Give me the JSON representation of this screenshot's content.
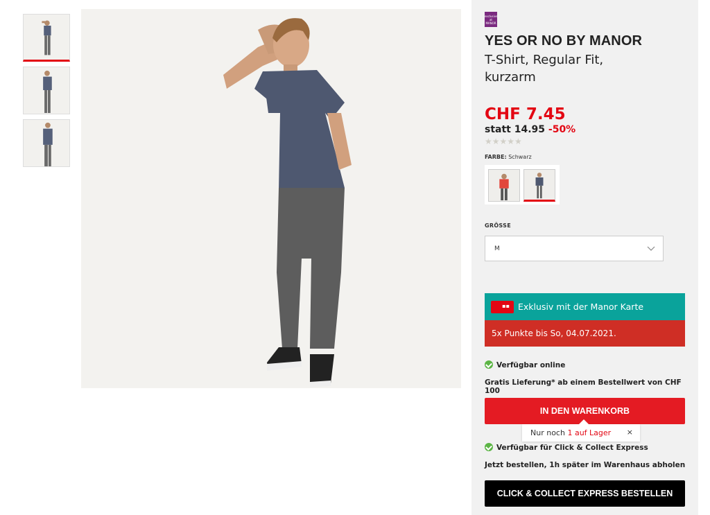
{
  "gallery": {
    "thumbnails": [
      {
        "alt": "front-view",
        "active": true
      },
      {
        "alt": "angle-view",
        "active": false
      },
      {
        "alt": "side-view",
        "active": false
      }
    ]
  },
  "product": {
    "brand_logo_text": "exclusive at MANOR",
    "brand": "YES OR NO BY MANOR",
    "name": "T-Shirt, Regular Fit, kurzarm",
    "price": "CHF 7.45",
    "old_price_prefix": "statt 14.95",
    "discount": "-50%",
    "stars": "★★★★★",
    "color_label": "FARBE:",
    "color_value": "Schwarz",
    "size_label": "GRÖSSE",
    "size_value": "M"
  },
  "promo": {
    "card_text": "Exklusiv mit der Manor Karte",
    "points_text": "5x Punkte bis So, 04.07.2021."
  },
  "availability": {
    "online": "Verfügbar online",
    "delivery": "Gratis Lieferung* ab einem Bestellwert von CHF 100",
    "cart_button": "IN DEN WARENKORB",
    "stock_prefix": "Nur noch",
    "stock_count": "1 auf Lager",
    "stock_close": "×",
    "click_collect": "Verfügbar für Click & Collect Express",
    "pickup_info": "Jetzt bestellen, 1h später im Warenhaus abholen",
    "cc_button": "CLICK & COLLECT EXPRESS BESTELLEN"
  },
  "colors": {
    "accent_red": "#e30613",
    "teal": "#0aa39b",
    "points_red": "#cf2e25",
    "check_green": "#5cb545"
  }
}
